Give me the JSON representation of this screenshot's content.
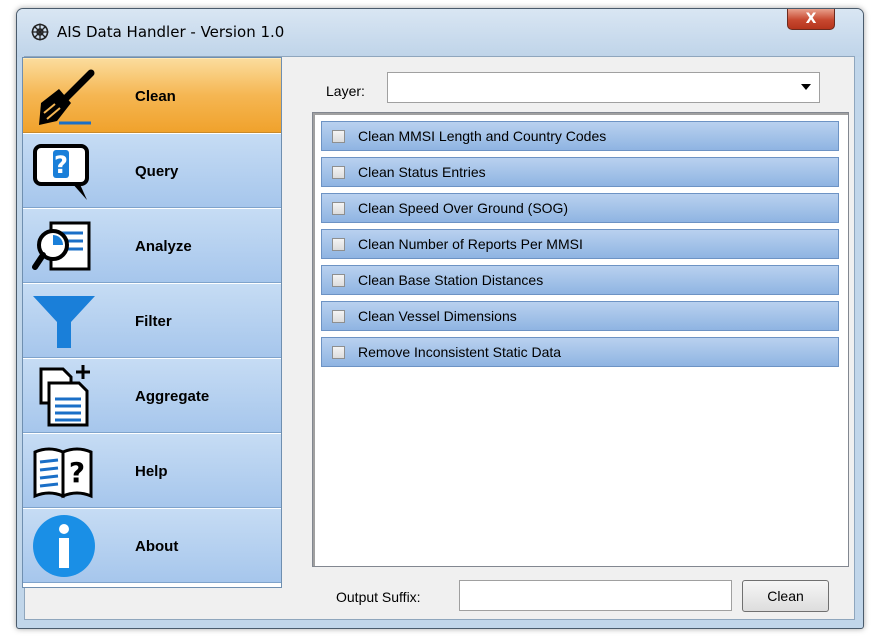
{
  "window": {
    "title": "AIS Data Handler - Version 1.0",
    "close_glyph": "X"
  },
  "sidebar": {
    "items": [
      {
        "label": "Clean",
        "icon": "broom-icon",
        "active": true
      },
      {
        "label": "Query",
        "icon": "question-bubble-icon",
        "active": false
      },
      {
        "label": "Analyze",
        "icon": "magnifier-chart-icon",
        "active": false
      },
      {
        "label": "Filter",
        "icon": "funnel-icon",
        "active": false
      },
      {
        "label": "Aggregate",
        "icon": "document-add-icon",
        "active": false
      },
      {
        "label": "Help",
        "icon": "book-help-icon",
        "active": false
      },
      {
        "label": "About",
        "icon": "info-icon",
        "active": false
      }
    ]
  },
  "main": {
    "layer_label": "Layer:",
    "layer_value": "",
    "options": [
      {
        "label": "Clean MMSI Length and Country Codes",
        "checked": false
      },
      {
        "label": "Clean Status Entries",
        "checked": false
      },
      {
        "label": "Clean Speed Over Ground (SOG)",
        "checked": false
      },
      {
        "label": "Clean Number of Reports Per MMSI",
        "checked": false
      },
      {
        "label": "Clean Base Station Distances",
        "checked": false
      },
      {
        "label": "Clean Vessel Dimensions",
        "checked": false
      },
      {
        "label": "Remove Inconsistent Static Data",
        "checked": false
      }
    ],
    "suffix_label": "Output Suffix:",
    "suffix_value": "",
    "action_button": "Clean"
  },
  "colors": {
    "active_nav": "#f5b652",
    "nav": "#b4d0f0",
    "row": "#a6c4ea",
    "close": "#c7482f"
  }
}
